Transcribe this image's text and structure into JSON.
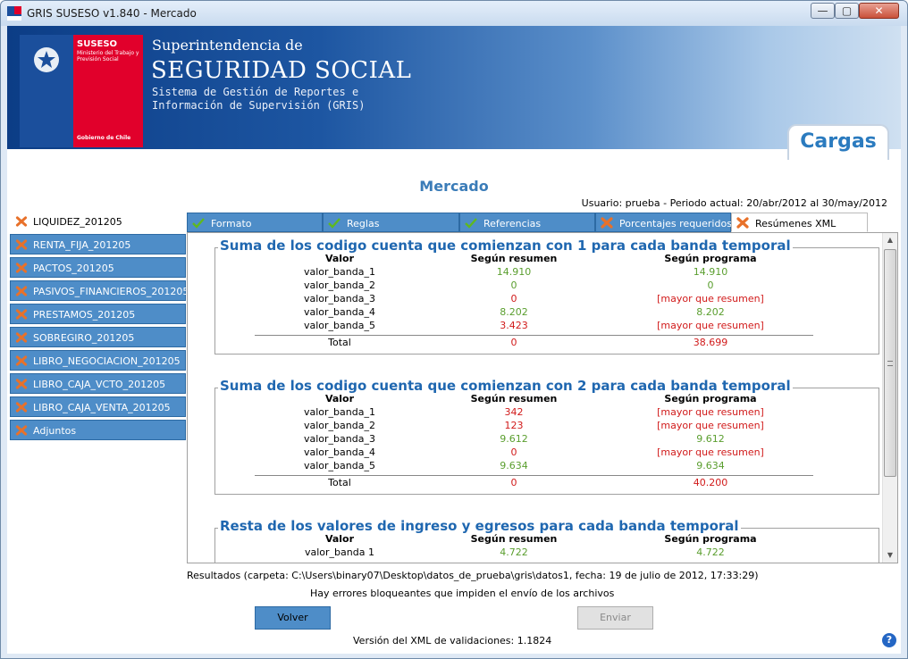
{
  "window": {
    "title": "GRIS SUSESO v1.840 - Mercado",
    "min_glyph": "—",
    "max_glyph": "▢",
    "close_glyph": "✕"
  },
  "banner": {
    "logo_name": "SUSESO",
    "logo_ministry": "Ministerio del Trabajo y Previsión Social",
    "logo_gob": "Gobierno de Chile",
    "super": "Superintendencia de",
    "seg": "SEGURIDAD SOCIAL",
    "sistema1": "Sistema de Gestión de Reportes e",
    "sistema2": "Información de Supervisión (GRIS)",
    "tab": "Cargas"
  },
  "header": {
    "title": "Mercado",
    "usuario": "Usuario: prueba - Periodo actual: 20/abr/2012 al 30/may/2012"
  },
  "sidebar": {
    "items": [
      {
        "label": "LIQUIDEZ_201205",
        "status": "error",
        "active": true
      },
      {
        "label": "RENTA_FIJA_201205",
        "status": "error"
      },
      {
        "label": "PACTOS_201205",
        "status": "error"
      },
      {
        "label": "PASIVOS_FINANCIEROS_201205",
        "status": "error"
      },
      {
        "label": "PRESTAMOS_201205",
        "status": "error"
      },
      {
        "label": "SOBREGIRO_201205",
        "status": "error"
      },
      {
        "label": "LIBRO_NEGOCIACION_201205",
        "status": "error"
      },
      {
        "label": "LIBRO_CAJA_VCTO_201205",
        "status": "error"
      },
      {
        "label": "LIBRO_CAJA_VENTA_201205",
        "status": "error"
      },
      {
        "label": "Adjuntos",
        "status": "error"
      }
    ]
  },
  "tabs": [
    {
      "label": "Formato",
      "status": "ok"
    },
    {
      "label": "Reglas",
      "status": "ok"
    },
    {
      "label": "Referencias",
      "status": "ok"
    },
    {
      "label": "Porcentajes requeridos",
      "status": "error"
    },
    {
      "label": "Resúmenes XML",
      "status": "error",
      "active": true
    }
  ],
  "sections": [
    {
      "title": "Suma de los codigo cuenta que comienzan con 1 para cada banda temporal",
      "headers": [
        "Valor",
        "Según resumen",
        "Según programa"
      ],
      "rows": [
        [
          "valor_banda_1",
          "14.910",
          "14.910"
        ],
        [
          "valor_banda_2",
          "0",
          "0"
        ],
        [
          "valor_banda_3",
          "0",
          "[mayor que resumen]"
        ],
        [
          "valor_banda_4",
          "8.202",
          "8.202"
        ],
        [
          "valor_banda_5",
          "3.423",
          "[mayor que resumen]"
        ]
      ],
      "total": [
        "Total",
        "0",
        "38.699"
      ]
    },
    {
      "title": "Suma de los codigo cuenta que comienzan con 2 para cada banda temporal",
      "headers": [
        "Valor",
        "Según resumen",
        "Según programa"
      ],
      "rows": [
        [
          "valor_banda_1",
          "342",
          "[mayor que resumen]"
        ],
        [
          "valor_banda_2",
          "123",
          "[mayor que resumen]"
        ],
        [
          "valor_banda_3",
          "9.612",
          "9.612"
        ],
        [
          "valor_banda_4",
          "0",
          "[mayor que resumen]"
        ],
        [
          "valor_banda_5",
          "9.634",
          "9.634"
        ]
      ],
      "total": [
        "Total",
        "0",
        "40.200"
      ]
    },
    {
      "title": "Resta de los valores de ingreso y egresos para cada banda temporal",
      "headers": [
        "Valor",
        "Según resumen",
        "Según programa"
      ],
      "rows": [
        [
          "valor_banda 1",
          "4.722",
          "4.722"
        ]
      ]
    }
  ],
  "footer": {
    "results": "Resultados (carpeta: C:\\Users\\binary07\\Desktop\\datos_de_prueba\\gris\\datos1, fecha: 19 de julio de 2012, 17:33:29)",
    "error": "Hay errores bloqueantes que impiden el envío de los archivos",
    "volver": "Volver",
    "enviar": "Enviar",
    "version": "Versión del XML de validaciones: 1.1824",
    "help": "?"
  },
  "colors": {
    "accent": "#4e8dc8",
    "ok": "#5a9e2e",
    "error": "#d11a1a",
    "title": "#1f67b0",
    "error_icon": "#e8712a"
  }
}
